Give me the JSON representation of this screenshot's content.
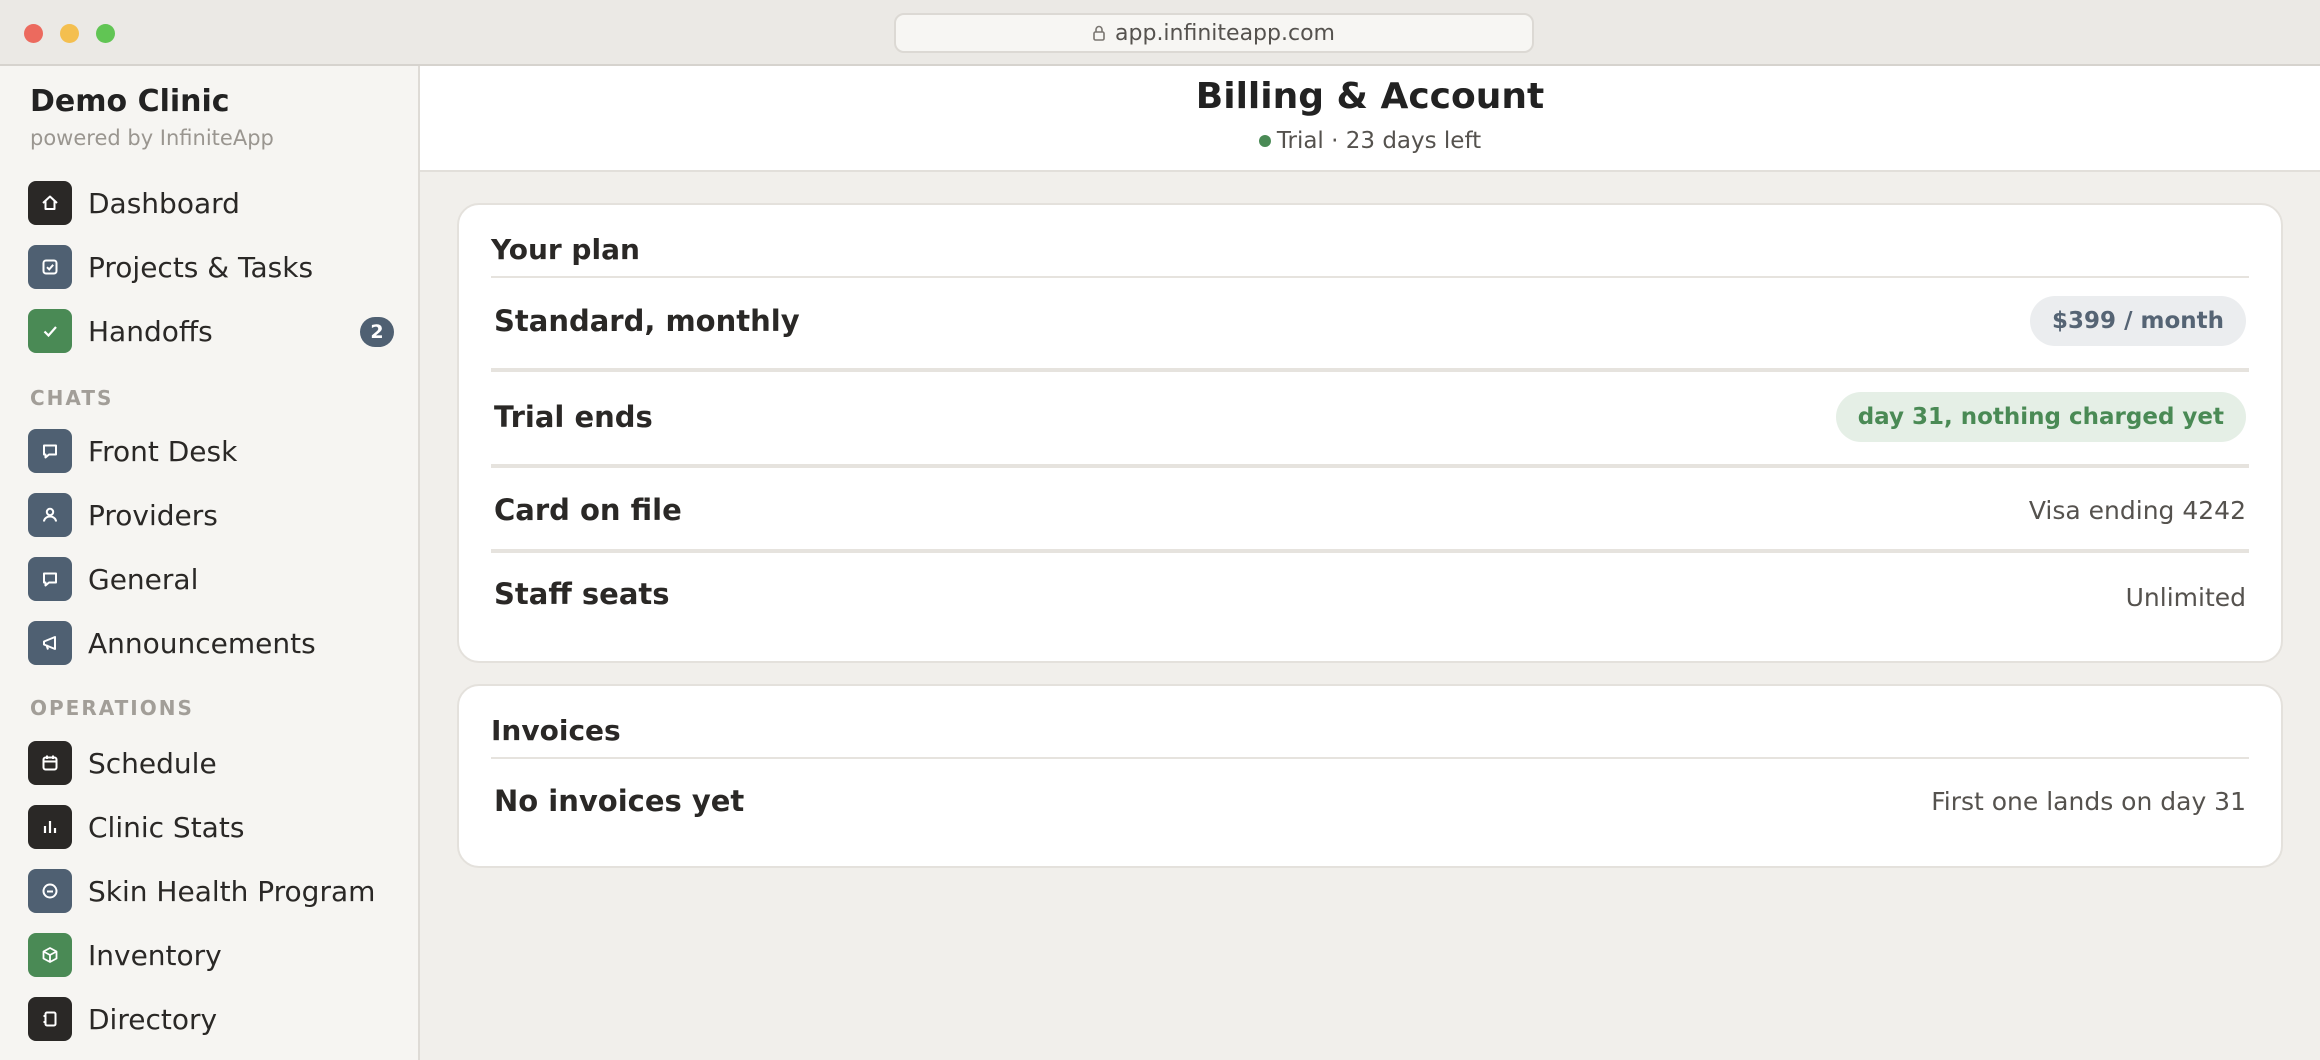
{
  "browser": {
    "url": "app.infiniteapp.com"
  },
  "sidebar": {
    "brand": "Demo Clinic",
    "brand_sub": "powered by InfiniteApp",
    "items": [
      {
        "label": "Dashboard",
        "icon": "home-icon"
      },
      {
        "label": "Projects & Tasks",
        "icon": "checkbox-icon"
      },
      {
        "label": "Handoffs",
        "icon": "check-icon",
        "badge": "2"
      }
    ],
    "chats_label": "CHATS",
    "chats": [
      {
        "label": "Front Desk",
        "icon": "chat-bubble-icon"
      },
      {
        "label": "Providers",
        "icon": "person-icon"
      },
      {
        "label": "General",
        "icon": "chat-bubble-icon"
      },
      {
        "label": "Announcements",
        "icon": "megaphone-icon"
      }
    ],
    "operations_label": "OPERATIONS",
    "operations": [
      {
        "label": "Schedule",
        "icon": "calendar-icon"
      },
      {
        "label": "Clinic Stats",
        "icon": "bar-chart-icon"
      },
      {
        "label": "Skin Health Program",
        "icon": "circle-minus-icon"
      },
      {
        "label": "Inventory",
        "icon": "box-icon"
      },
      {
        "label": "Directory",
        "icon": "book-icon"
      }
    ]
  },
  "header": {
    "title": "Billing & Account",
    "status": "Trial · 23 days left",
    "status_color": "#4a8a55"
  },
  "plan_card": {
    "title": "Your plan",
    "rows": [
      {
        "label": "Standard, monthly",
        "value": "$399 / month"
      },
      {
        "label": "Trial ends",
        "value": "day 31, nothing charged yet"
      },
      {
        "label": "Card on file",
        "value": "Visa ending 4242"
      },
      {
        "label": "Staff seats",
        "value": "Unlimited"
      }
    ]
  },
  "invoices_card": {
    "title": "Invoices",
    "rows": [
      {
        "label": "No invoices yet",
        "value": "First one lands on day 31"
      }
    ]
  },
  "colors": {
    "accent_green": "#4a8a55",
    "slate": "#4f6072",
    "dark": "#2a2826"
  }
}
